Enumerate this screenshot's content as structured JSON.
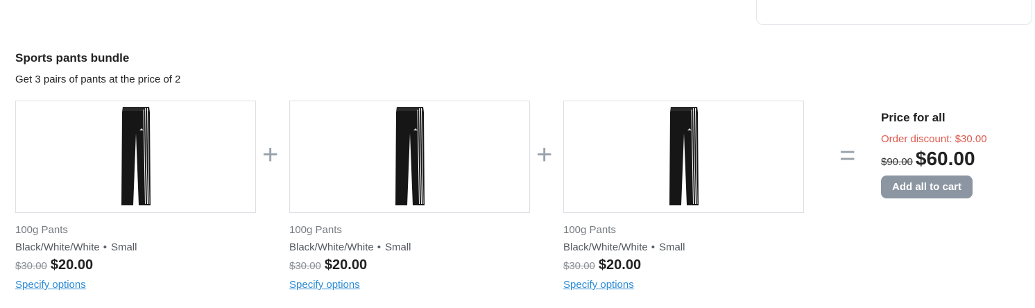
{
  "bundle": {
    "title": "Sports pants bundle",
    "description": "Get 3 pairs of pants at the price of 2"
  },
  "products": [
    {
      "name": "100g Pants",
      "color": "Black/White/White",
      "separator": "•",
      "size": "Small",
      "old_price": "$30.00",
      "new_price": "$20.00",
      "specify_label": "Specify options"
    },
    {
      "name": "100g Pants",
      "color": "Black/White/White",
      "separator": "•",
      "size": "Small",
      "old_price": "$30.00",
      "new_price": "$20.00",
      "specify_label": "Specify options"
    },
    {
      "name": "100g Pants",
      "color": "Black/White/White",
      "separator": "•",
      "size": "Small",
      "old_price": "$30.00",
      "new_price": "$20.00",
      "specify_label": "Specify options"
    }
  ],
  "operators": {
    "plus": "+",
    "equals": "="
  },
  "summary": {
    "title": "Price for all",
    "discount": "Order discount: $30.00",
    "old_total": "$90.00",
    "new_total": "$60.00",
    "add_all_label": "Add all to cart"
  },
  "colors": {
    "link": "#2a8ad4",
    "discount": "#e05a4e",
    "button_bg": "#8c96a2",
    "operator": "#9aa2ab"
  },
  "icons": {
    "product_image": "track-pants-image"
  }
}
